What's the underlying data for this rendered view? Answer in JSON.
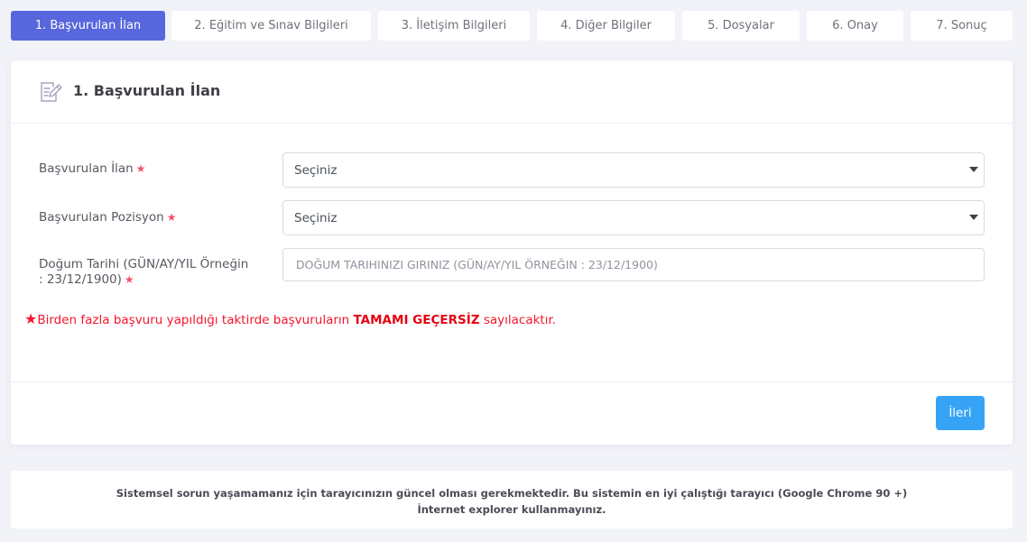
{
  "wizard": {
    "steps": [
      {
        "label": "1. Başvurulan İlan",
        "active": true
      },
      {
        "label": "2. Eğitim ve Sınav Bilgileri",
        "active": false
      },
      {
        "label": "3. İletişim Bilgileri",
        "active": false
      },
      {
        "label": "4. Diğer Bilgiler",
        "active": false
      },
      {
        "label": "5. Dosyalar",
        "active": false
      },
      {
        "label": "6. Onay",
        "active": false
      },
      {
        "label": "7. Sonuç",
        "active": false
      }
    ]
  },
  "card": {
    "title": "1. Başvurulan İlan",
    "icon": "edit-document-icon"
  },
  "form": {
    "ilan_label": "Başvurulan İlan",
    "ilan_value": "Seçiniz",
    "pozisyon_label": "Başvurulan Pozisyon",
    "pozisyon_value": "Seçiniz",
    "dogum_label_line1": "Doğum Tarihi (GÜN/AY/YIL Örneğin",
    "dogum_label_line2": ": 23/12/1900)",
    "dogum_placeholder": "DOĞUM TARIHINIZI GIRINIZ (GÜN/AY/YIL ÖRNEĞIN : 23/12/1900)",
    "required_marker": "★"
  },
  "warning": {
    "star": "★",
    "prefix": "Birden fazla başvuru yapıldığı taktirde başvuruların ",
    "emphasis": "TAMAMI GEÇERSİZ",
    "suffix": " sayılacaktır."
  },
  "actions": {
    "next_label": "İleri"
  },
  "notice": {
    "line1": "Sistemsel sorun yaşamamanız için tarayıcınızın güncel olması gerekmektedir. Bu sistemin en iyi çalıştığı tarayıcı (Google Chrome 90 +)",
    "line2": "İnternet explorer kullanmayınız."
  },
  "colors": {
    "accent": "#5867dd",
    "button": "#36a3f7",
    "required": "#f4516c",
    "warning": "#f4162c"
  }
}
